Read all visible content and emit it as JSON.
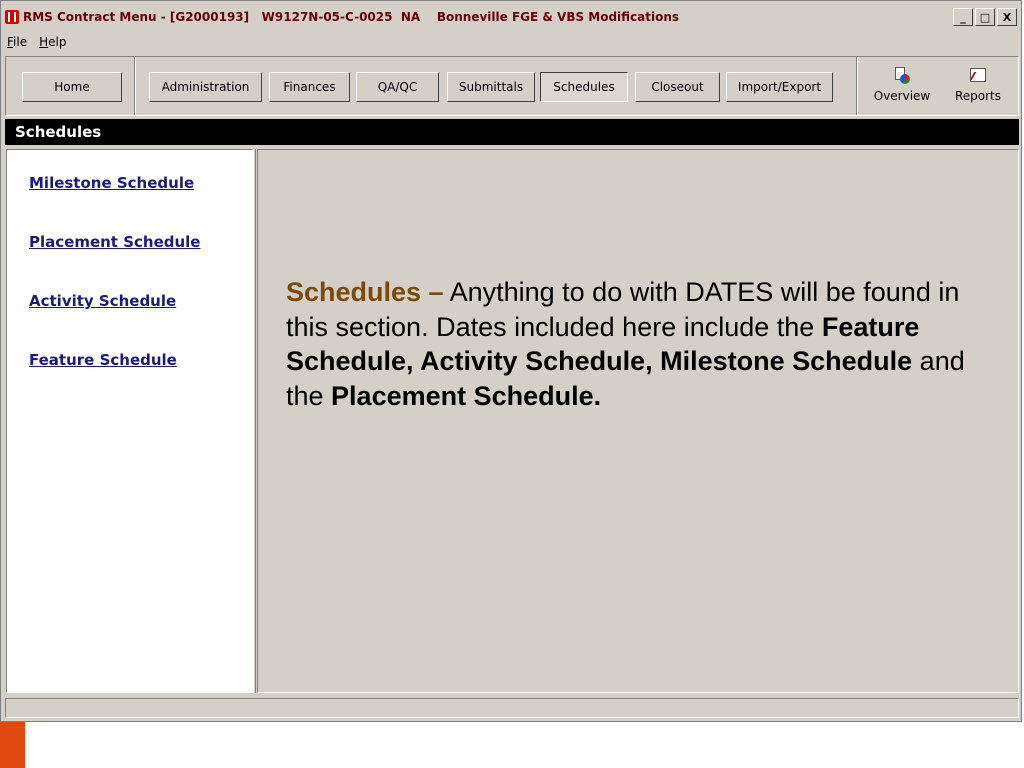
{
  "window": {
    "title": "RMS Contract Menu - [G2000193]   W9127N-05-C-0025  NA    Bonneville FGE & VBS Modifications",
    "minimize_glyph": "_",
    "maximize_glyph": "□",
    "close_glyph": "X"
  },
  "menu": {
    "file_first": "F",
    "file_rest": "ile",
    "help_first": "H",
    "help_rest": "elp"
  },
  "toolbar": {
    "home": "Home",
    "administration": "Administration",
    "finances": "Finances",
    "qaqc": "QA/QC",
    "submittals": "Submittals",
    "schedules": "Schedules",
    "closeout": "Closeout",
    "import_export": "Import/Export",
    "overview": "Overview",
    "reports": "Reports",
    "active_tab": "Schedules"
  },
  "section": {
    "title": "Schedules"
  },
  "sidebar": {
    "items": [
      {
        "label": "Milestone Schedule"
      },
      {
        "label": "Placement Schedule"
      },
      {
        "label": "Activity Schedule"
      },
      {
        "label": "Feature Schedule"
      }
    ]
  },
  "main": {
    "lead": "Schedules –",
    "text1": " Anything to do with DATES will be found in this section. Dates included here include the ",
    "bold1": "Feature Schedule, Activity Schedule, Milestone Schedule",
    "text2": " and the ",
    "bold2": "Placement Schedule."
  },
  "colors": {
    "title_text": "#6a0000",
    "lead_text": "#7a4a0a",
    "link": "#1a1a80",
    "accent_block": "#e04a10"
  }
}
